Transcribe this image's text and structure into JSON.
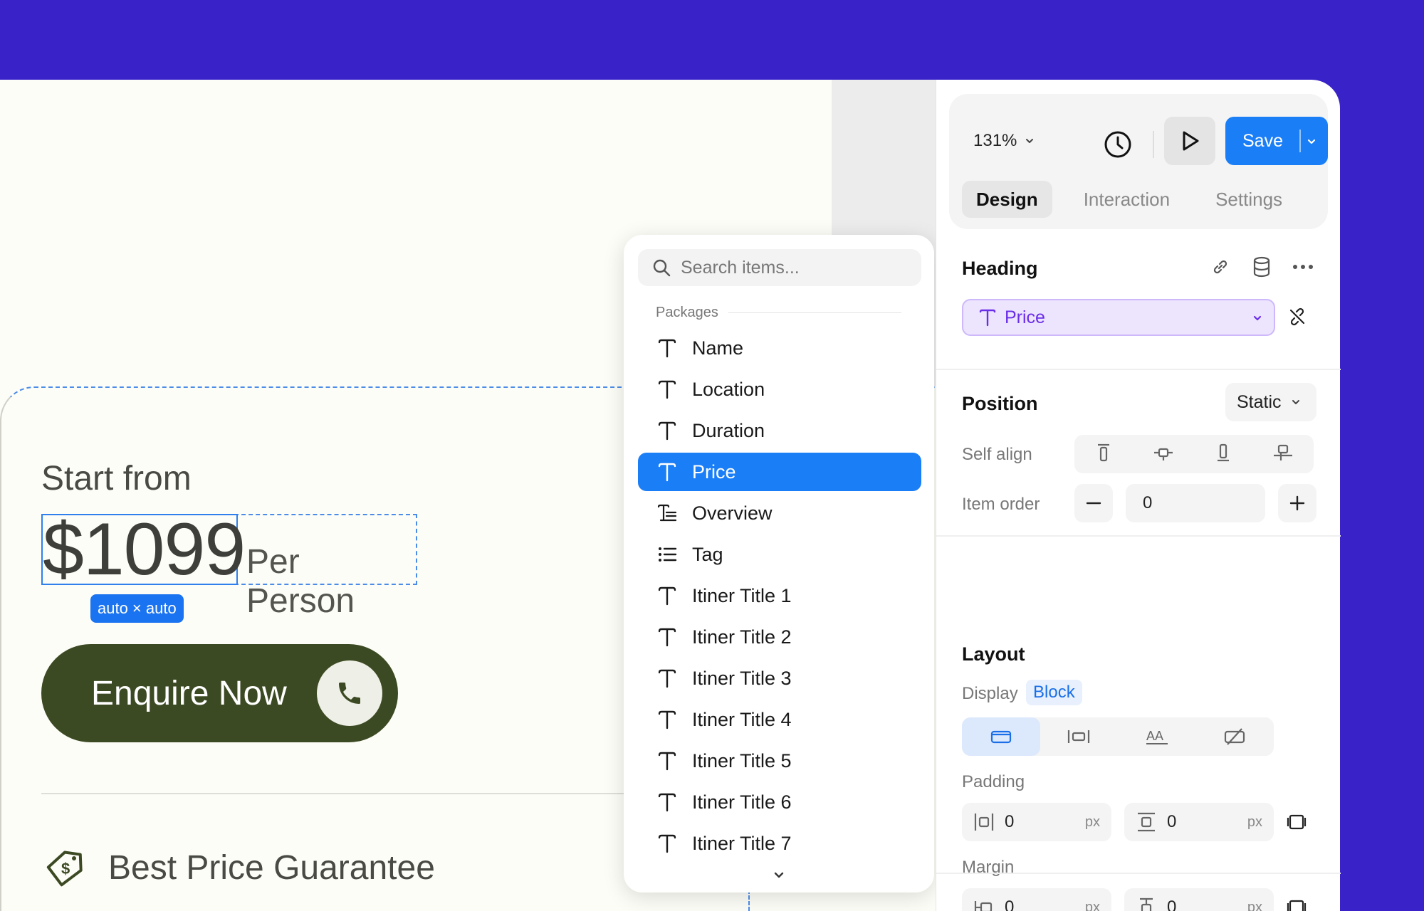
{
  "canvas": {
    "start_from": "Start from",
    "price": "$1099",
    "per_person": "Per Person",
    "size_badge": "auto × auto",
    "enquire_label": "Enquire Now",
    "guarantee_text": "Best Price Guarantee"
  },
  "dropdown": {
    "search_placeholder": "Search items...",
    "group_label": "Packages",
    "items": [
      {
        "label": "Name",
        "icon": "text-icon"
      },
      {
        "label": "Location",
        "icon": "text-icon"
      },
      {
        "label": "Duration",
        "icon": "text-icon"
      },
      {
        "label": "Price",
        "icon": "text-icon",
        "selected": true
      },
      {
        "label": "Overview",
        "icon": "rich-text-icon"
      },
      {
        "label": "Tag",
        "icon": "list-icon"
      },
      {
        "label": "Itiner Title 1",
        "icon": "text-icon"
      },
      {
        "label": "Itiner Title 2",
        "icon": "text-icon"
      },
      {
        "label": "Itiner Title 3",
        "icon": "text-icon"
      },
      {
        "label": "Itiner Title 4",
        "icon": "text-icon"
      },
      {
        "label": "Itiner Title 5",
        "icon": "text-icon"
      },
      {
        "label": "Itiner Title 6",
        "icon": "text-icon"
      },
      {
        "label": "Itiner Title 7",
        "icon": "text-icon"
      }
    ]
  },
  "toolbar": {
    "zoom": "131%",
    "save_label": "Save",
    "tabs": [
      "Design",
      "Interaction",
      "Settings"
    ],
    "active_tab": "Design"
  },
  "panel": {
    "heading_title": "Heading",
    "binding_value": "Price",
    "position_title": "Position",
    "position_value": "Static",
    "self_align_label": "Self align",
    "item_order_label": "Item order",
    "item_order_value": "0",
    "layout_title": "Layout",
    "display_label": "Display",
    "display_value": "Block",
    "padding_label": "Padding",
    "padding_x": "0",
    "padding_y": "0",
    "margin_label": "Margin",
    "margin_x": "0",
    "margin_y": "0",
    "unit": "px"
  },
  "colors": {
    "background": "#3a22c9",
    "accent": "#1a7ef7",
    "button_dark_green": "#3c4a23",
    "binding_purple": "#6a2ee8"
  }
}
